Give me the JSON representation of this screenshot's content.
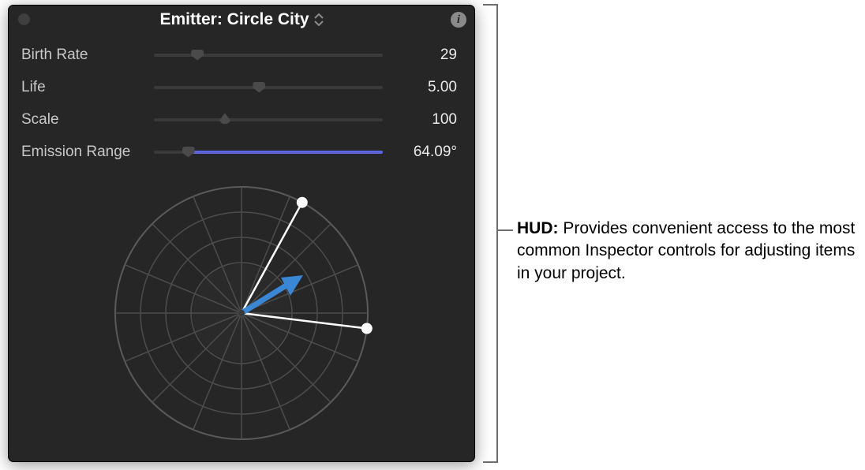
{
  "titlebar": {
    "title": "Emitter: Circle City"
  },
  "params": [
    {
      "label": "Birth Rate",
      "value": "29",
      "pos": 19,
      "fill": false
    },
    {
      "label": "Life",
      "value": "5.00",
      "pos": 46,
      "fill": false
    },
    {
      "label": "Scale",
      "value": "100",
      "pos": 31,
      "fill": false,
      "tri": true
    },
    {
      "label": "Emission Range",
      "value": "64.09°",
      "pos": 15,
      "fill": true
    }
  ],
  "callout": {
    "label": "HUD:",
    "text": "Provides convenient access to the most common Inspector controls for adjusting items in your project."
  }
}
